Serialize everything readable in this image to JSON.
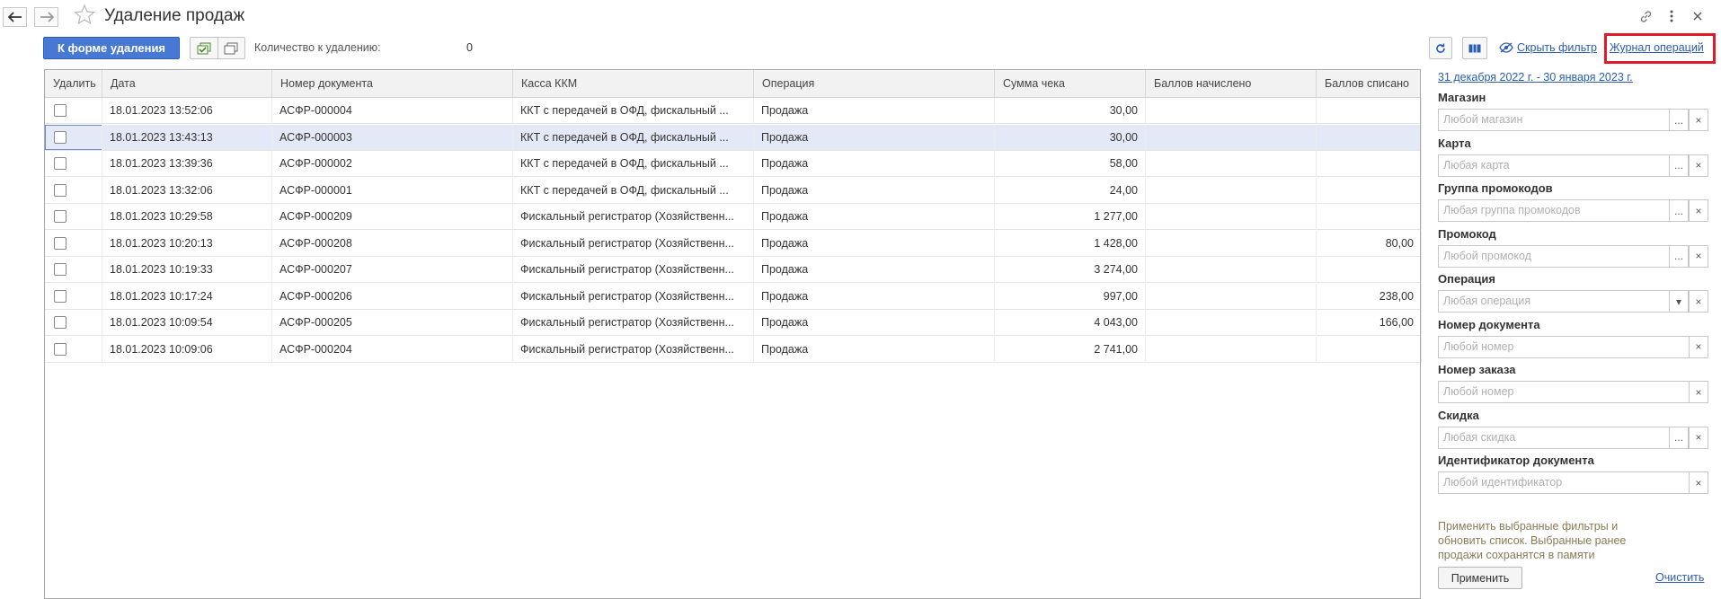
{
  "window": {
    "title": "Удаление продаж"
  },
  "toolbar": {
    "primary_button": "К форме удаления",
    "count_label": "Количество к удалению:",
    "count_value": "0",
    "hide_filter": "Скрыть фильтр",
    "operations_journal": "Журнал операций"
  },
  "table": {
    "columns": [
      "Удалить",
      "Дата",
      "Номер документа",
      "Касса ККМ",
      "Операция",
      "Сумма чека",
      "Баллов начислено",
      "Баллов списано"
    ],
    "rows": [
      {
        "date": "18.01.2023 13:52:06",
        "doc": "АСФР-000004",
        "kkm": "ККТ с передачей в ОФД, фискальный ...",
        "op": "Продажа",
        "sum": "30,00",
        "accrued": "",
        "written": ""
      },
      {
        "date": "18.01.2023 13:43:13",
        "doc": "АСФР-000003",
        "kkm": "ККТ с передачей в ОФД, фискальный ...",
        "op": "Продажа",
        "sum": "30,00",
        "accrued": "",
        "written": ""
      },
      {
        "date": "18.01.2023 13:39:36",
        "doc": "АСФР-000002",
        "kkm": "ККТ с передачей в ОФД, фискальный ...",
        "op": "Продажа",
        "sum": "58,00",
        "accrued": "",
        "written": ""
      },
      {
        "date": "18.01.2023 13:32:06",
        "doc": "АСФР-000001",
        "kkm": "ККТ с передачей в ОФД, фискальный ...",
        "op": "Продажа",
        "sum": "24,00",
        "accrued": "",
        "written": ""
      },
      {
        "date": "18.01.2023 10:29:58",
        "doc": "АСФР-000209",
        "kkm": "Фискальный регистратор (Хозяйственн...",
        "op": "Продажа",
        "sum": "1 277,00",
        "accrued": "",
        "written": ""
      },
      {
        "date": "18.01.2023 10:20:13",
        "doc": "АСФР-000208",
        "kkm": "Фискальный регистратор (Хозяйственн...",
        "op": "Продажа",
        "sum": "1 428,00",
        "accrued": "",
        "written": "80,00"
      },
      {
        "date": "18.01.2023 10:19:33",
        "doc": "АСФР-000207",
        "kkm": "Фискальный регистратор (Хозяйственн...",
        "op": "Продажа",
        "sum": "3 274,00",
        "accrued": "",
        "written": ""
      },
      {
        "date": "18.01.2023 10:17:24",
        "doc": "АСФР-000206",
        "kkm": "Фискальный регистратор (Хозяйственн...",
        "op": "Продажа",
        "sum": "997,00",
        "accrued": "",
        "written": "238,00"
      },
      {
        "date": "18.01.2023 10:09:54",
        "doc": "АСФР-000205",
        "kkm": "Фискальный регистратор (Хозяйственн...",
        "op": "Продажа",
        "sum": "4 043,00",
        "accrued": "",
        "written": "166,00"
      },
      {
        "date": "18.01.2023 10:09:06",
        "doc": "АСФР-000204",
        "kkm": "Фискальный регистратор (Хозяйственн...",
        "op": "Продажа",
        "sum": "2 741,00",
        "accrued": "",
        "written": ""
      }
    ]
  },
  "filter": {
    "period": "31 декабря 2022 г. - 30 января 2023 г.",
    "fields": [
      {
        "label": "Магазин",
        "placeholder": "Любой магазин",
        "buttons": [
          "...",
          "×"
        ]
      },
      {
        "label": "Карта",
        "placeholder": "Любая карта",
        "buttons": [
          "...",
          "×"
        ]
      },
      {
        "label": "Группа промокодов",
        "placeholder": "Любая группа промокодов",
        "buttons": [
          "...",
          "×"
        ]
      },
      {
        "label": "Промокод",
        "placeholder": "Любой промокод",
        "buttons": [
          "...",
          "×"
        ]
      },
      {
        "label": "Операция",
        "placeholder": "Любая операция",
        "buttons": [
          "▾",
          "×"
        ]
      },
      {
        "label": "Номер документа",
        "placeholder": "Любой номер",
        "buttons": [
          "×"
        ]
      },
      {
        "label": "Номер заказа",
        "placeholder": "Любой номер",
        "buttons": [
          "×"
        ]
      },
      {
        "label": "Скидка",
        "placeholder": "Любая скидка",
        "buttons": [
          "...",
          "×"
        ]
      },
      {
        "label": "Идентификатор документа",
        "placeholder": "Любой идентификатор",
        "buttons": [
          "×"
        ]
      }
    ],
    "hint": "Применить выбранные фильтры и обновить список. Выбранные ранее продажи сохранятся в памяти",
    "apply": "Применить",
    "clear": "Очистить"
  },
  "colors": {
    "primary": "#4779d4",
    "link": "#2a5db0",
    "highlight_frame": "#e0192b",
    "selected_row": "#e3e9f6"
  }
}
